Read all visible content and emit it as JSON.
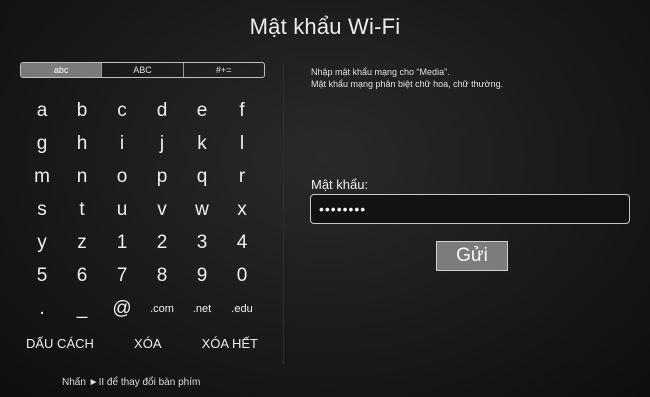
{
  "title": "Mật khẩu Wi-Fi",
  "keyboard_tabs": [
    "abc",
    "ABC",
    "#+="
  ],
  "keyboard_rows": [
    [
      "a",
      "b",
      "c",
      "d",
      "e",
      "f"
    ],
    [
      "g",
      "h",
      "i",
      "j",
      "k",
      "l"
    ],
    [
      "m",
      "n",
      "o",
      "p",
      "q",
      "r"
    ],
    [
      "s",
      "t",
      "u",
      "v",
      "w",
      "x"
    ],
    [
      "y",
      "z",
      "1",
      "2",
      "3",
      "4"
    ],
    [
      "5",
      "6",
      "7",
      "8",
      "9",
      "0"
    ],
    [
      ".",
      "_",
      "@",
      ".com",
      ".net",
      ".edu"
    ]
  ],
  "actions": {
    "space": "DẤU CÁCH",
    "delete": "XÓA",
    "clear": "XÓA HẾT"
  },
  "hint": "Nhấn ►II để thay đổi bàn phím",
  "info": {
    "line1": "Nhập mật khẩu mạng cho “Media”.",
    "line2": "Mật khẩu mạng phân biệt chữ hoa, chữ thường."
  },
  "password": {
    "label": "Mật khẩu:",
    "value": "••••••••"
  },
  "submit_label": "Gửi",
  "colors": {
    "background": "#1a1a1c",
    "active_tab": "#7a7a7a",
    "button": "#7c7c7e"
  }
}
